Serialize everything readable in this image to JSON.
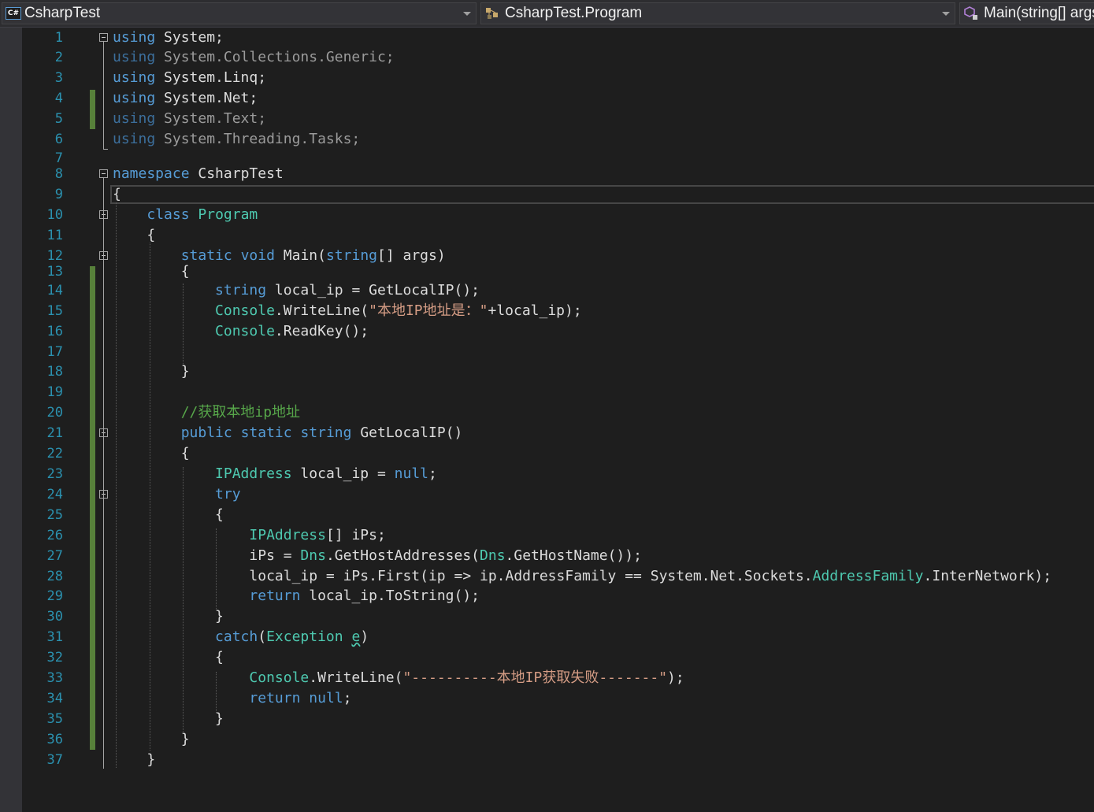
{
  "nav": {
    "project": "CsharpTest",
    "type": "CsharpTest.Program",
    "member": "Main(string[] args)",
    "project_icon": "csharp-project-icon",
    "type_icon": "class-icon",
    "member_icon": "method-icon"
  },
  "lines": [
    {
      "n": "1",
      "t": [
        [
          "kw",
          "using"
        ],
        [
          "p",
          " System;"
        ]
      ]
    },
    {
      "n": "2",
      "t": [
        [
          "dimk",
          "using"
        ],
        [
          "dim",
          " System.Collections.Generic;"
        ]
      ]
    },
    {
      "n": "3",
      "t": [
        [
          "kw",
          "using"
        ],
        [
          "p",
          " System.Linq;"
        ]
      ]
    },
    {
      "n": "4",
      "t": [
        [
          "kw",
          "using"
        ],
        [
          "p",
          " System.Net;"
        ]
      ]
    },
    {
      "n": "5",
      "t": [
        [
          "dimk",
          "using"
        ],
        [
          "dim",
          " System.Text;"
        ]
      ]
    },
    {
      "n": "6",
      "t": [
        [
          "dimk",
          "using"
        ],
        [
          "dim",
          " System.Threading.Tasks;"
        ]
      ]
    },
    {
      "n": "7",
      "t": []
    },
    {
      "n": "8",
      "t": [
        [
          "kw",
          "namespace"
        ],
        [
          "p",
          " CsharpTest"
        ]
      ]
    },
    {
      "n": "9",
      "t": [
        [
          "p",
          "{"
        ]
      ]
    },
    {
      "n": "10",
      "t": [
        [
          "p",
          "    "
        ],
        [
          "kw",
          "class"
        ],
        [
          "p",
          " "
        ],
        [
          "ty",
          "Program"
        ]
      ]
    },
    {
      "n": "11",
      "t": [
        [
          "p",
          "    {"
        ]
      ]
    },
    {
      "n": "12",
      "t": [
        [
          "p",
          "        "
        ],
        [
          "kw",
          "static"
        ],
        [
          "p",
          " "
        ],
        [
          "kw",
          "void"
        ],
        [
          "p",
          " Main("
        ],
        [
          "kw",
          "string"
        ],
        [
          "p",
          "[] args)"
        ]
      ]
    },
    {
      "n": "13",
      "t": [
        [
          "p",
          "        {"
        ]
      ]
    },
    {
      "n": "14",
      "t": [
        [
          "p",
          "            "
        ],
        [
          "kw",
          "string"
        ],
        [
          "p",
          " local_ip = GetLocalIP();"
        ]
      ]
    },
    {
      "n": "15",
      "t": [
        [
          "p",
          "            "
        ],
        [
          "ty",
          "Console"
        ],
        [
          "p",
          ".WriteLine("
        ],
        [
          "st",
          "\"本地IP地址是：\""
        ],
        [
          "p",
          "+local_ip);"
        ]
      ]
    },
    {
      "n": "16",
      "t": [
        [
          "p",
          "            "
        ],
        [
          "ty",
          "Console"
        ],
        [
          "p",
          ".ReadKey();"
        ]
      ]
    },
    {
      "n": "17",
      "t": []
    },
    {
      "n": "18",
      "t": [
        [
          "p",
          "        }"
        ]
      ]
    },
    {
      "n": "19",
      "t": []
    },
    {
      "n": "20",
      "t": [
        [
          "p",
          "        "
        ],
        [
          "cm",
          "//获取本地ip地址"
        ]
      ]
    },
    {
      "n": "21",
      "t": [
        [
          "p",
          "        "
        ],
        [
          "kw",
          "public"
        ],
        [
          "p",
          " "
        ],
        [
          "kw",
          "static"
        ],
        [
          "p",
          " "
        ],
        [
          "kw",
          "string"
        ],
        [
          "p",
          " GetLocalIP()"
        ]
      ]
    },
    {
      "n": "22",
      "t": [
        [
          "p",
          "        {"
        ]
      ]
    },
    {
      "n": "23",
      "t": [
        [
          "p",
          "            "
        ],
        [
          "ty",
          "IPAddress"
        ],
        [
          "p",
          " local_ip = "
        ],
        [
          "kw",
          "null"
        ],
        [
          "p",
          ";"
        ]
      ]
    },
    {
      "n": "24",
      "t": [
        [
          "p",
          "            "
        ],
        [
          "kw",
          "try"
        ]
      ]
    },
    {
      "n": "25",
      "t": [
        [
          "p",
          "            {"
        ]
      ]
    },
    {
      "n": "26",
      "t": [
        [
          "p",
          "                "
        ],
        [
          "ty",
          "IPAddress"
        ],
        [
          "p",
          "[] iPs;"
        ]
      ]
    },
    {
      "n": "27",
      "t": [
        [
          "p",
          "                iPs = "
        ],
        [
          "ty",
          "Dns"
        ],
        [
          "p",
          ".GetHostAddresses("
        ],
        [
          "ty",
          "Dns"
        ],
        [
          "p",
          ".GetHostName());"
        ]
      ]
    },
    {
      "n": "28",
      "t": [
        [
          "p",
          "                local_ip = iPs.First(ip => ip.AddressFamily == System.Net.Sockets."
        ],
        [
          "ty",
          "AddressFamily"
        ],
        [
          "p",
          ".InterNetwork);"
        ]
      ]
    },
    {
      "n": "29",
      "t": [
        [
          "p",
          "                "
        ],
        [
          "kw",
          "return"
        ],
        [
          "p",
          " local_ip.ToString();"
        ]
      ]
    },
    {
      "n": "30",
      "t": [
        [
          "p",
          "            }"
        ]
      ]
    },
    {
      "n": "31",
      "t": [
        [
          "p",
          "            "
        ],
        [
          "kw",
          "catch"
        ],
        [
          "p",
          "("
        ],
        [
          "ty",
          "Exception"
        ],
        [
          "p",
          " "
        ],
        [
          "sq",
          "e"
        ],
        [
          "p",
          ")"
        ]
      ]
    },
    {
      "n": "32",
      "t": [
        [
          "p",
          "            {"
        ]
      ]
    },
    {
      "n": "33",
      "t": [
        [
          "p",
          "                "
        ],
        [
          "ty",
          "Console"
        ],
        [
          "p",
          ".WriteLine("
        ],
        [
          "st",
          "\"----------本地IP获取失败-------\""
        ],
        [
          "p",
          ");"
        ]
      ]
    },
    {
      "n": "34",
      "t": [
        [
          "p",
          "                "
        ],
        [
          "kw",
          "return"
        ],
        [
          "p",
          " "
        ],
        [
          "kw",
          "null"
        ],
        [
          "p",
          ";"
        ]
      ]
    },
    {
      "n": "35",
      "t": [
        [
          "p",
          "            }"
        ]
      ]
    },
    {
      "n": "36",
      "t": [
        [
          "p",
          "        }"
        ]
      ]
    },
    {
      "n": "37",
      "t": [
        [
          "p",
          "    }"
        ]
      ]
    }
  ]
}
